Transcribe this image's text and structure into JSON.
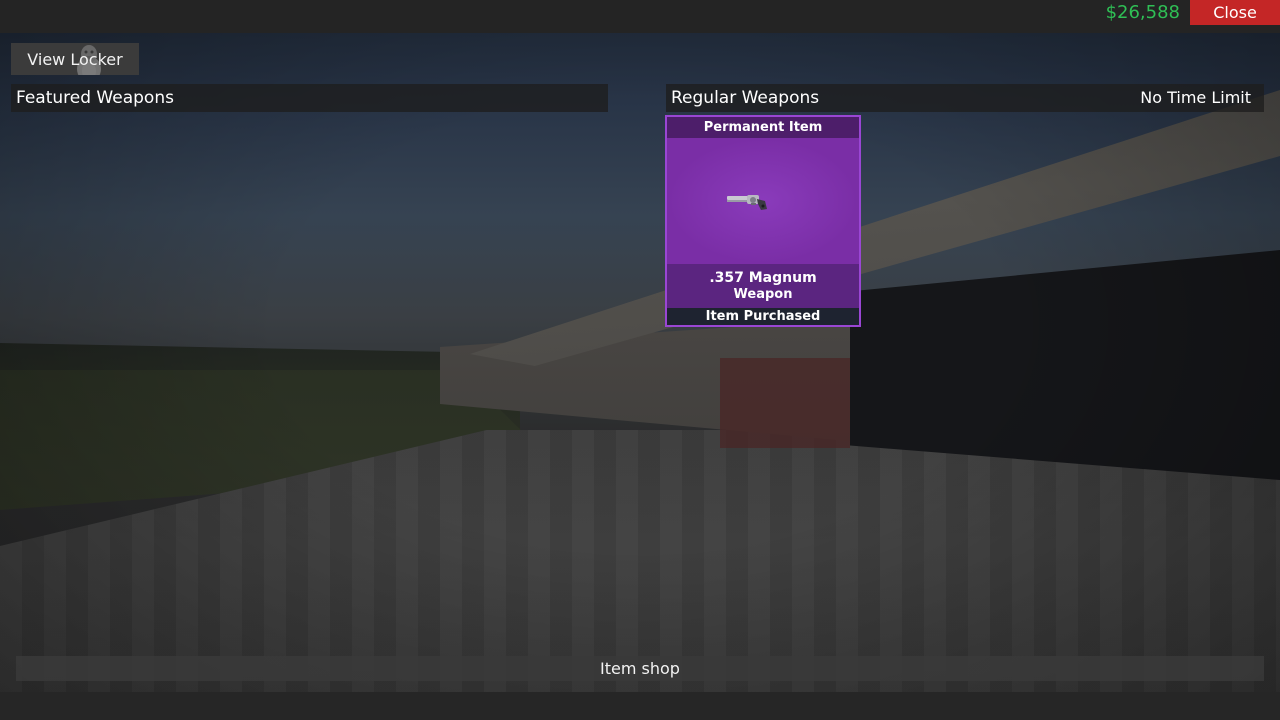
{
  "header": {
    "money": "$26,588",
    "close_label": "Close"
  },
  "locker": {
    "button_label": "View Locker",
    "icon": "penguin-icon"
  },
  "sections": {
    "featured_title": "Featured Weapons",
    "regular_title": "Regular Weapons",
    "time_limit": "No Time Limit"
  },
  "items": [
    {
      "tag": "Permanent Item",
      "name": ".357 Magnum",
      "type": "Weapon",
      "status": "Item Purchased",
      "icon": "revolver-icon",
      "rarity_color": "#7c2ea8"
    }
  ],
  "footer": {
    "label": "Item shop"
  },
  "colors": {
    "money": "#2fbf55",
    "close": "#c42626",
    "card_border": "#9a46d4"
  }
}
